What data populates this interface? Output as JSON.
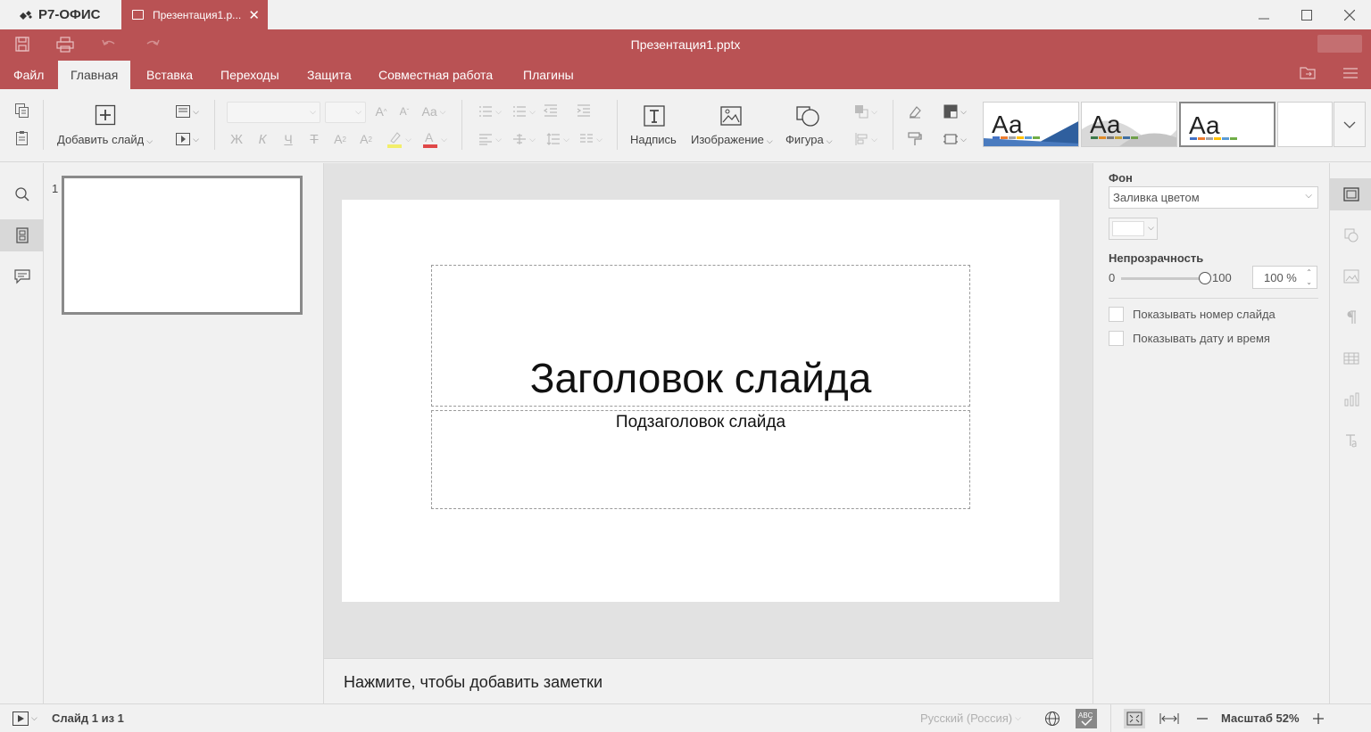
{
  "app": {
    "brand": "Р7-ОФИС",
    "tab_title": "Презентация1.р..."
  },
  "header": {
    "doc_title": "Презентация1.pptx",
    "menu": [
      "Файл",
      "Главная",
      "Вставка",
      "Переходы",
      "Защита",
      "Совместная работа",
      "Плагины"
    ],
    "active_menu": "Главная"
  },
  "toolbar": {
    "add_slide": "Добавить слайд",
    "font_buttons": [
      "Ж",
      "К",
      "Ч",
      "Т"
    ],
    "insert_text": "Надпись",
    "insert_image": "Изображение",
    "insert_shape": "Фигура",
    "themes": [
      "Аа",
      "Аа",
      "Аа"
    ]
  },
  "slides_panel": {
    "slide_number": "1"
  },
  "slide": {
    "title": "Заголовок слайда",
    "subtitle": "Подзаголовок слайда"
  },
  "notes": {
    "placeholder": "Нажмите, чтобы добавить заметки"
  },
  "right_panel": {
    "background_label": "Фон",
    "fill_type": "Заливка цветом",
    "fill_color": "#ffffff",
    "opacity_label": "Непрозрачность",
    "opacity_min": "0",
    "opacity_max": "100",
    "opacity_value": "100 %",
    "opacity_fraction": 1.0,
    "show_slide_number": "Показывать номер слайда",
    "show_date_time": "Показывать дату и время"
  },
  "statusbar": {
    "slide_info": "Слайд 1 из 1",
    "language": "Русский (Россия)",
    "zoom": "Масштаб 52%"
  },
  "colors": {
    "accent": "#b95254",
    "panel_bg": "#f1f1f1"
  }
}
